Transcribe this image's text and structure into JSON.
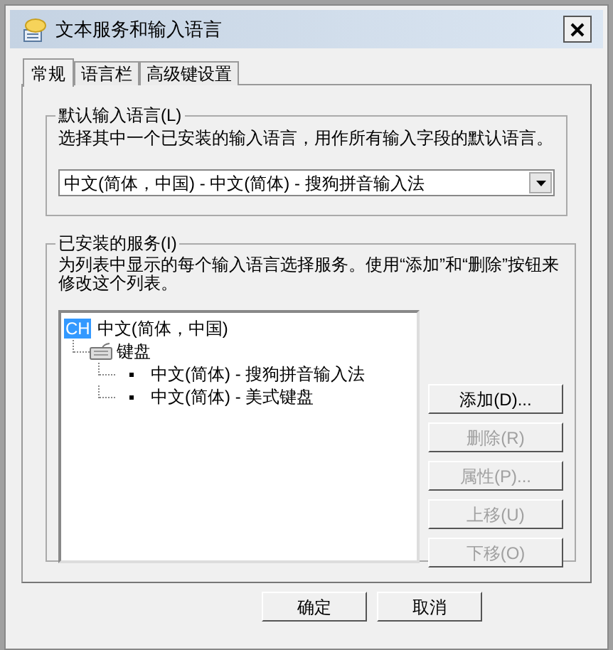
{
  "window": {
    "title": "文本服务和输入语言"
  },
  "tabs": [
    {
      "label": "常规",
      "selected": true
    },
    {
      "label": "语言栏",
      "selected": false
    },
    {
      "label": "高级键设置",
      "selected": false
    }
  ],
  "default_language": {
    "legend": "默认输入语言(L)",
    "description": "选择其中一个已安装的输入语言，用作所有输入字段的默认语言。",
    "dropdown": {
      "value": "中文(简体，中国) - 中文(简体) - 搜狗拼音输入法"
    }
  },
  "installed_services": {
    "legend": "已安装的服务(I)",
    "description": "为列表中显示的每个输入语言选择服务。使用“添加”和“删除”按钮来修改这个列表。",
    "tree": [
      {
        "kind": "language",
        "badge": "CH",
        "label": "中文(简体，中国)",
        "children": [
          {
            "kind": "category",
            "label": "键盘",
            "children": [
              {
                "kind": "service",
                "label": "中文(简体) - 搜狗拼音输入法"
              },
              {
                "kind": "service",
                "label": "中文(简体) - 美式键盘"
              }
            ]
          }
        ]
      }
    ],
    "buttons": [
      {
        "label": "添加(D)...",
        "disabled": false
      },
      {
        "label": "删除(R)",
        "disabled": true
      },
      {
        "label": "属性(P)...",
        "disabled": true
      },
      {
        "label": "上移(U)",
        "disabled": true
      },
      {
        "label": "下移(O)",
        "disabled": true
      }
    ]
  },
  "footer_buttons": [
    {
      "label": "确定"
    },
    {
      "label": "取消"
    }
  ]
}
